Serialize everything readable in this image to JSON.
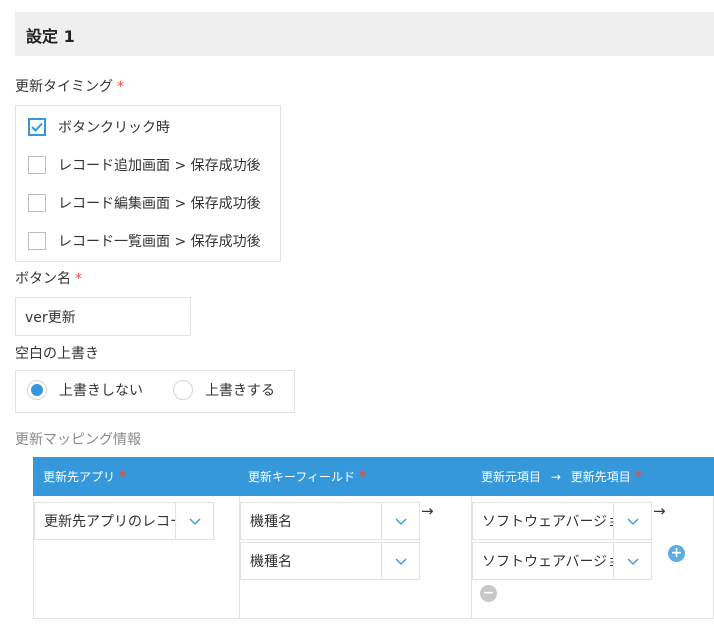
{
  "section": {
    "title": "設定 1"
  },
  "update_timing": {
    "label": "更新タイミング",
    "required_mark": "*",
    "options": [
      {
        "label": "ボタンクリック時",
        "checked": true
      },
      {
        "label": "レコード追加画面 > 保存成功後",
        "checked": false
      },
      {
        "label": "レコード編集画面 > 保存成功後",
        "checked": false
      },
      {
        "label": "レコード一覧画面 > 保存成功後",
        "checked": false
      }
    ]
  },
  "button_name": {
    "label": "ボタン名",
    "required_mark": "*",
    "value": "ver更新"
  },
  "overwrite_blank": {
    "label": "空白の上書き",
    "options": [
      {
        "label": "上書きしない",
        "selected": true
      },
      {
        "label": "上書きする",
        "selected": false
      }
    ]
  },
  "mapping": {
    "label": "更新マッピング情報",
    "headers": {
      "target_app": "更新先アプリ",
      "key_field": "更新キーフィールド",
      "source_item": "更新元項目",
      "arrow": "→",
      "target_item": "更新先項目",
      "required_mark": "*"
    },
    "target_app_value": "更新先アプリのレコード",
    "key_fields": [
      "機種名",
      "機種名"
    ],
    "field_pairs": [
      "ソフトウェアバージョン",
      "ソフトウェアバージョン"
    ],
    "row_arrow": "→",
    "add_label": "+",
    "remove_label": "−"
  },
  "colors": {
    "accent": "#3498db",
    "required": "#e74c3c",
    "header_bg": "#efefef",
    "add_button": "#5dade2",
    "remove_button": "#c8c8c8"
  }
}
